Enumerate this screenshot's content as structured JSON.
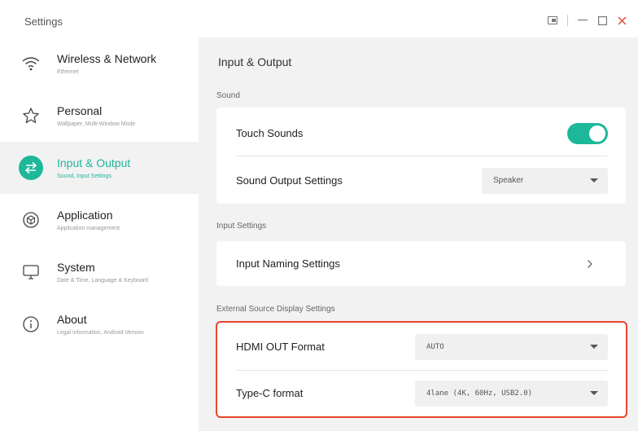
{
  "app": {
    "title": "Settings"
  },
  "window_controls": [
    "picture-in-picture-icon",
    "minimize-icon",
    "maximize-icon",
    "close-icon"
  ],
  "colors": {
    "accent": "#1db79a",
    "highlight": "#e8462f"
  },
  "sidebar": {
    "items": [
      {
        "label": "Wireless & Network",
        "sub": "Ethernet",
        "icon": "wifi-icon",
        "active": false
      },
      {
        "label": "Personal",
        "sub": "Wallpaper, Multi-Window Mode",
        "icon": "star-icon",
        "active": false
      },
      {
        "label": "Input & Output",
        "sub": "Sound, Input Settings",
        "icon": "swap-arrows-icon",
        "active": true
      },
      {
        "label": "Application",
        "sub": "Application management",
        "icon": "cube-icon",
        "active": false
      },
      {
        "label": "System",
        "sub": "Date & Time, Language & Keyboard",
        "icon": "monitor-icon",
        "active": false
      },
      {
        "label": "About",
        "sub": "Legal information, Android Version",
        "icon": "info-icon",
        "active": false
      }
    ]
  },
  "main": {
    "title": "Input & Output",
    "sound": {
      "section_label": "Sound",
      "touch_sounds": {
        "label": "Touch Sounds",
        "enabled": true
      },
      "sound_output": {
        "label": "Sound Output Settings",
        "value": "Speaker"
      }
    },
    "input": {
      "section_label": "Input Settings",
      "naming": {
        "label": "Input Naming Settings"
      }
    },
    "external": {
      "section_label": "External Source Display Settings",
      "hdmi_out": {
        "label": "HDMI OUT Format",
        "value": "AUTO"
      },
      "type_c": {
        "label": "Type-C format",
        "value": "4lane (4K, 60Hz, USB2.0)"
      }
    }
  }
}
